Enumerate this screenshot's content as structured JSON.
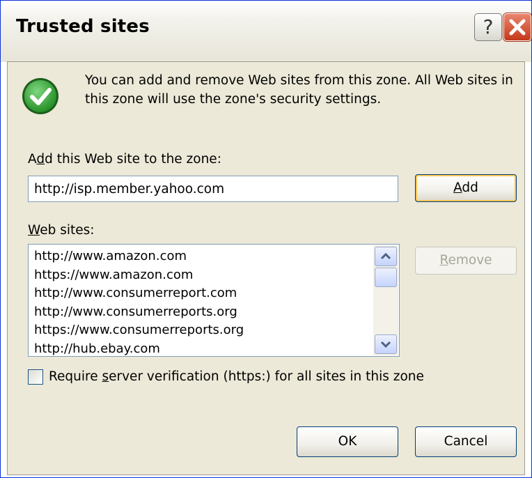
{
  "dialog": {
    "title": "Trusted sites",
    "help_label": "?",
    "info_text": "You can add and remove Web sites from this zone. All Web sites in this zone will use the zone's security settings."
  },
  "add_site": {
    "label_pre": "A",
    "label_ul": "d",
    "label_post": "d this Web site to the zone:",
    "value": "http://isp.member.yahoo.com",
    "add_ul": "A",
    "add_post": "dd"
  },
  "web_sites": {
    "label_ul": "W",
    "label_post": "eb sites:",
    "items": [
      "http://www.amazon.com",
      "https://www.amazon.com",
      "http://www.consumerreport.com",
      "http://www.consumerreports.org",
      "https://www.consumerreports.org",
      "http://hub.ebay.com"
    ],
    "remove_ul": "R",
    "remove_post": "emove"
  },
  "verification": {
    "pre": "Require ",
    "ul": "s",
    "post": "erver verification (https:) for all sites in this zone",
    "checked": false
  },
  "buttons": {
    "ok": "OK",
    "cancel": "Cancel"
  },
  "icons": {
    "check": "check-icon",
    "close": "close-icon",
    "help": "help-icon",
    "scroll_up": "scroll-up-icon",
    "scroll_down": "scroll-down-icon"
  },
  "colors": {
    "title_border": "#0831d9",
    "close_button": "#c4391b",
    "check_green": "#2d9e2d",
    "dialog_face": "#ece9d8"
  }
}
